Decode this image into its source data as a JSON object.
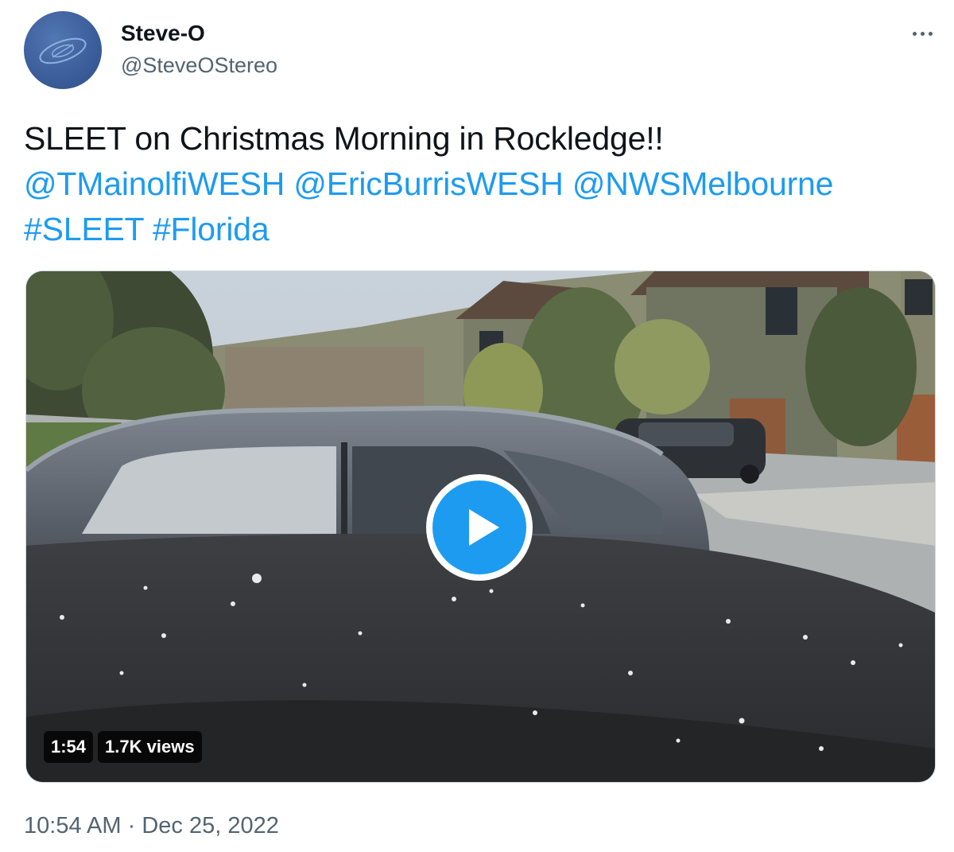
{
  "author": {
    "display_name": "Steve-O",
    "handle": "@SteveOStereo",
    "avatar_icon": "blue-circle-logo-icon"
  },
  "menu": {
    "more_icon": "more-horizontal-icon"
  },
  "tweet": {
    "text_plain": "SLEET on Christmas Morning in Rockledge!!",
    "mentions": [
      "@TMainolfiWESH",
      "@EricBurrisWESH",
      "@NWSMelbourne"
    ],
    "hashtags": [
      "#SLEET",
      "#Florida"
    ]
  },
  "media": {
    "type": "video",
    "description_icon": "play-icon",
    "duration": "1:54",
    "views": "1.7K views"
  },
  "timestamp": {
    "time": "10:54 AM",
    "separator": "·",
    "date": "Dec 25, 2022"
  },
  "colors": {
    "link": "#1d9bf0",
    "secondary_text": "#536471",
    "primary_text": "#0f1419",
    "play_button": "#1d9bf0"
  }
}
